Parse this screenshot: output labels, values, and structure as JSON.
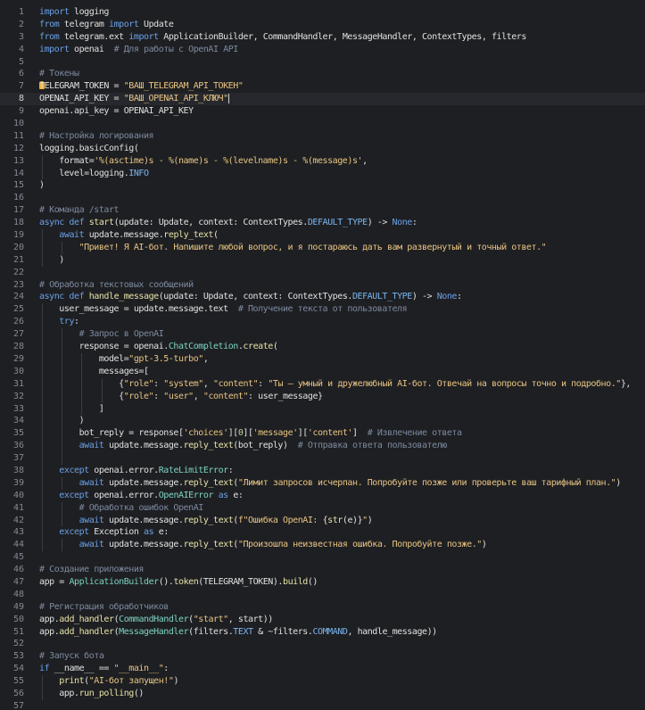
{
  "editor": {
    "active_line": 8,
    "lines": [
      {
        "n": "1",
        "segs": [
          [
            "kw",
            "import"
          ],
          [
            "var",
            " logging"
          ]
        ]
      },
      {
        "n": "2",
        "segs": [
          [
            "kw",
            "from"
          ],
          [
            "var",
            " telegram "
          ],
          [
            "kw",
            "import"
          ],
          [
            "var",
            " Update"
          ]
        ]
      },
      {
        "n": "3",
        "segs": [
          [
            "kw",
            "from"
          ],
          [
            "var",
            " telegram.ext "
          ],
          [
            "kw",
            "import"
          ],
          [
            "var",
            " ApplicationBuilder, CommandHandler, MessageHandler, ContextTypes, filters"
          ]
        ]
      },
      {
        "n": "4",
        "segs": [
          [
            "kw",
            "import"
          ],
          [
            "var",
            " openai  "
          ],
          [
            "cm",
            "# Для работы с OpenAI API"
          ]
        ]
      },
      {
        "n": "5",
        "segs": []
      },
      {
        "n": "6",
        "segs": [
          [
            "cm",
            "# Токены"
          ]
        ]
      },
      {
        "n": "7",
        "segs": [
          [
            "var",
            "TELEGRAM_TOKEN = "
          ],
          [
            "str",
            "\"ВАШ_TELEGRAM_API_ТОКЕН\""
          ]
        ],
        "bulb": true
      },
      {
        "n": "8",
        "segs": [
          [
            "var",
            "OPENAI_API_KEY = "
          ],
          [
            "str",
            "\"ВАШ_OPENAI_API_КЛЮЧ\""
          ]
        ],
        "caret": true
      },
      {
        "n": "9",
        "segs": [
          [
            "var",
            "openai.api_key = OPENAI_API_KEY"
          ]
        ]
      },
      {
        "n": "10",
        "segs": []
      },
      {
        "n": "11",
        "segs": [
          [
            "cm",
            "# Настройка логирования"
          ]
        ]
      },
      {
        "n": "12",
        "segs": [
          [
            "var",
            "logging.basicConfig("
          ]
        ]
      },
      {
        "n": "13",
        "segs": [
          [
            "var",
            "    format="
          ],
          [
            "str",
            "'%(asctime)s - %(name)s - %(levelname)s - %(message)s'"
          ],
          [
            "var",
            ","
          ]
        ],
        "g": [
          1
        ]
      },
      {
        "n": "14",
        "segs": [
          [
            "var",
            "    level=logging."
          ],
          [
            "const",
            "INFO"
          ]
        ],
        "g": [
          1
        ]
      },
      {
        "n": "15",
        "segs": [
          [
            "var",
            ")"
          ]
        ]
      },
      {
        "n": "16",
        "segs": []
      },
      {
        "n": "17",
        "segs": [
          [
            "cm",
            "# Команда /start"
          ]
        ]
      },
      {
        "n": "18",
        "segs": [
          [
            "kw",
            "async def"
          ],
          [
            "var",
            " "
          ],
          [
            "fn",
            "start"
          ],
          [
            "var",
            "(update: Update, context: ContextTypes."
          ],
          [
            "const",
            "DEFAULT_TYPE"
          ],
          [
            "var",
            ") -> "
          ],
          [
            "kw",
            "None"
          ],
          [
            "var",
            ":"
          ]
        ]
      },
      {
        "n": "19",
        "segs": [
          [
            "var",
            "    "
          ],
          [
            "kw",
            "await"
          ],
          [
            "var",
            " update.message."
          ],
          [
            "fn",
            "reply_text"
          ],
          [
            "var",
            "("
          ]
        ],
        "g": [
          1
        ]
      },
      {
        "n": "20",
        "segs": [
          [
            "var",
            "        "
          ],
          [
            "str",
            "\"Привет! Я AI-бот. Напишите любой вопрос, и я постараюсь дать вам развернутый и точный ответ.\""
          ]
        ],
        "g": [
          1,
          2
        ]
      },
      {
        "n": "21",
        "segs": [
          [
            "var",
            "    )"
          ]
        ],
        "g": [
          1
        ]
      },
      {
        "n": "22",
        "segs": []
      },
      {
        "n": "23",
        "segs": [
          [
            "cm",
            "# Обработка текстовых сообщений"
          ]
        ]
      },
      {
        "n": "24",
        "segs": [
          [
            "kw",
            "async def"
          ],
          [
            "var",
            " "
          ],
          [
            "fn",
            "handle_message"
          ],
          [
            "var",
            "(update: Update, context: ContextTypes."
          ],
          [
            "const",
            "DEFAULT_TYPE"
          ],
          [
            "var",
            ") -> "
          ],
          [
            "kw",
            "None"
          ],
          [
            "var",
            ":"
          ]
        ]
      },
      {
        "n": "25",
        "segs": [
          [
            "var",
            "    user_message = update.message.text  "
          ],
          [
            "cm",
            "# Получение текста от пользователя"
          ]
        ],
        "g": [
          1
        ]
      },
      {
        "n": "26",
        "segs": [
          [
            "var",
            "    "
          ],
          [
            "kw",
            "try"
          ],
          [
            "var",
            ":"
          ]
        ],
        "g": [
          1
        ]
      },
      {
        "n": "27",
        "segs": [
          [
            "var",
            "        "
          ],
          [
            "cm",
            "# Запрос в OpenAI"
          ]
        ],
        "g": [
          1,
          2
        ]
      },
      {
        "n": "28",
        "segs": [
          [
            "var",
            "        response = openai."
          ],
          [
            "cls",
            "ChatCompletion"
          ],
          [
            "var",
            "."
          ],
          [
            "fn",
            "create"
          ],
          [
            "var",
            "("
          ]
        ],
        "g": [
          1,
          2
        ]
      },
      {
        "n": "29",
        "segs": [
          [
            "var",
            "            model="
          ],
          [
            "str",
            "\"gpt-3.5-turbo\""
          ],
          [
            "var",
            ","
          ]
        ],
        "g": [
          1,
          2,
          3
        ]
      },
      {
        "n": "30",
        "segs": [
          [
            "var",
            "            messages=["
          ]
        ],
        "g": [
          1,
          2,
          3
        ]
      },
      {
        "n": "31",
        "segs": [
          [
            "var",
            "                {"
          ],
          [
            "str",
            "\"role\""
          ],
          [
            "var",
            ": "
          ],
          [
            "str",
            "\"system\""
          ],
          [
            "var",
            ", "
          ],
          [
            "str",
            "\"content\""
          ],
          [
            "var",
            ": "
          ],
          [
            "str",
            "\"Ты — умный и дружелюбный AI-бот. Отвечай на вопросы точно и подробно.\""
          ],
          [
            "var",
            "},"
          ]
        ],
        "g": [
          1,
          2,
          3,
          4
        ]
      },
      {
        "n": "32",
        "segs": [
          [
            "var",
            "                {"
          ],
          [
            "str",
            "\"role\""
          ],
          [
            "var",
            ": "
          ],
          [
            "str",
            "\"user\""
          ],
          [
            "var",
            ", "
          ],
          [
            "str",
            "\"content\""
          ],
          [
            "var",
            ": user_message}"
          ]
        ],
        "g": [
          1,
          2,
          3,
          4
        ]
      },
      {
        "n": "33",
        "segs": [
          [
            "var",
            "            ]"
          ]
        ],
        "g": [
          1,
          2,
          3
        ]
      },
      {
        "n": "34",
        "segs": [
          [
            "var",
            "        )"
          ]
        ],
        "g": [
          1,
          2
        ]
      },
      {
        "n": "35",
        "segs": [
          [
            "var",
            "        bot_reply = response["
          ],
          [
            "str",
            "'choices'"
          ],
          [
            "var",
            "]["
          ],
          [
            "num",
            "0"
          ],
          [
            "var",
            "]["
          ],
          [
            "str",
            "'message'"
          ],
          [
            "var",
            "]["
          ],
          [
            "str",
            "'content'"
          ],
          [
            "var",
            "]  "
          ],
          [
            "cm",
            "# Извлечение ответа"
          ]
        ],
        "g": [
          1,
          2
        ]
      },
      {
        "n": "36",
        "segs": [
          [
            "var",
            "        "
          ],
          [
            "kw",
            "await"
          ],
          [
            "var",
            " update.message."
          ],
          [
            "fn",
            "reply_text"
          ],
          [
            "var",
            "(bot_reply)  "
          ],
          [
            "cm",
            "# Отправка ответа пользователю"
          ]
        ],
        "g": [
          1,
          2
        ]
      },
      {
        "n": "37",
        "segs": [],
        "g": [
          1,
          2
        ]
      },
      {
        "n": "38",
        "segs": [
          [
            "var",
            "    "
          ],
          [
            "kw",
            "except"
          ],
          [
            "var",
            " openai.error."
          ],
          [
            "cls",
            "RateLimitError"
          ],
          [
            "var",
            ":"
          ]
        ],
        "g": [
          1
        ]
      },
      {
        "n": "39",
        "segs": [
          [
            "var",
            "        "
          ],
          [
            "kw",
            "await"
          ],
          [
            "var",
            " update.message."
          ],
          [
            "fn",
            "reply_text"
          ],
          [
            "var",
            "("
          ],
          [
            "str",
            "\"Лимит запросов исчерпан. Попробуйте позже или проверьте ваш тарифный план.\""
          ],
          [
            "var",
            ")"
          ]
        ],
        "g": [
          1,
          2
        ]
      },
      {
        "n": "40",
        "segs": [
          [
            "var",
            "    "
          ],
          [
            "kw",
            "except"
          ],
          [
            "var",
            " openai.error."
          ],
          [
            "cls",
            "OpenAIError"
          ],
          [
            "var",
            " "
          ],
          [
            "kw",
            "as"
          ],
          [
            "var",
            " e:"
          ]
        ],
        "g": [
          1
        ]
      },
      {
        "n": "41",
        "segs": [
          [
            "var",
            "        "
          ],
          [
            "cm",
            "# Обработка ошибок OpenAI"
          ]
        ],
        "g": [
          1,
          2
        ]
      },
      {
        "n": "42",
        "segs": [
          [
            "var",
            "        "
          ],
          [
            "kw",
            "await"
          ],
          [
            "var",
            " update.message."
          ],
          [
            "fn",
            "reply_text"
          ],
          [
            "var",
            "("
          ],
          [
            "str",
            "f\"Ошибка OpenAI: "
          ],
          [
            "var",
            "{"
          ],
          [
            "fn",
            "str"
          ],
          [
            "var",
            "(e)}"
          ],
          [
            "str",
            "\""
          ],
          [
            "var",
            ")"
          ]
        ],
        "g": [
          1,
          2
        ]
      },
      {
        "n": "43",
        "segs": [
          [
            "var",
            "    "
          ],
          [
            "kw",
            "except"
          ],
          [
            "var",
            " Exception "
          ],
          [
            "kw",
            "as"
          ],
          [
            "var",
            " e:"
          ]
        ],
        "g": [
          1
        ]
      },
      {
        "n": "44",
        "segs": [
          [
            "var",
            "        "
          ],
          [
            "kw",
            "await"
          ],
          [
            "var",
            " update.message."
          ],
          [
            "fn",
            "reply_text"
          ],
          [
            "var",
            "("
          ],
          [
            "str",
            "\"Произошла неизвестная ошибка. Попробуйте позже.\""
          ],
          [
            "var",
            ")"
          ]
        ],
        "g": [
          1,
          2
        ]
      },
      {
        "n": "45",
        "segs": []
      },
      {
        "n": "46",
        "segs": [
          [
            "cm",
            "# Создание приложения"
          ]
        ]
      },
      {
        "n": "47",
        "segs": [
          [
            "var",
            "app = "
          ],
          [
            "cls",
            "ApplicationBuilder"
          ],
          [
            "var",
            "()."
          ],
          [
            "fn",
            "token"
          ],
          [
            "var",
            "(TELEGRAM_TOKEN)."
          ],
          [
            "fn",
            "build"
          ],
          [
            "var",
            "()"
          ]
        ]
      },
      {
        "n": "48",
        "segs": []
      },
      {
        "n": "49",
        "segs": [
          [
            "cm",
            "# Регистрация обработчиков"
          ]
        ]
      },
      {
        "n": "50",
        "segs": [
          [
            "var",
            "app."
          ],
          [
            "fn",
            "add_handler"
          ],
          [
            "var",
            "("
          ],
          [
            "cls",
            "CommandHandler"
          ],
          [
            "var",
            "("
          ],
          [
            "str",
            "\"start\""
          ],
          [
            "var",
            ", start))"
          ]
        ]
      },
      {
        "n": "51",
        "segs": [
          [
            "var",
            "app."
          ],
          [
            "fn",
            "add_handler"
          ],
          [
            "var",
            "("
          ],
          [
            "cls",
            "MessageHandler"
          ],
          [
            "var",
            "(filters."
          ],
          [
            "const",
            "TEXT"
          ],
          [
            "var",
            " & ~filters."
          ],
          [
            "const",
            "COMMAND"
          ],
          [
            "var",
            ", handle_message))"
          ]
        ]
      },
      {
        "n": "52",
        "segs": []
      },
      {
        "n": "53",
        "segs": [
          [
            "cm",
            "# Запуск бота"
          ]
        ]
      },
      {
        "n": "54",
        "segs": [
          [
            "kw",
            "if"
          ],
          [
            "var",
            " __name__ == "
          ],
          [
            "str",
            "\"__main__\""
          ],
          [
            "var",
            ":"
          ]
        ]
      },
      {
        "n": "55",
        "segs": [
          [
            "var",
            "    "
          ],
          [
            "fn",
            "print"
          ],
          [
            "var",
            "("
          ],
          [
            "str",
            "\"AI-бот запущен!\""
          ],
          [
            "var",
            ")"
          ]
        ],
        "g": [
          1
        ]
      },
      {
        "n": "56",
        "segs": [
          [
            "var",
            "    app."
          ],
          [
            "fn",
            "run_polling"
          ],
          [
            "var",
            "()"
          ]
        ],
        "g": [
          1
        ]
      },
      {
        "n": "57",
        "segs": []
      }
    ]
  },
  "colors": {
    "background": "#1e1f22",
    "keyword": "#6aa0e6",
    "string": "#e8c483",
    "comment": "#7d8aa0",
    "function": "#e6e1a8",
    "class": "#7bd3c2",
    "line_number": "#858994"
  }
}
